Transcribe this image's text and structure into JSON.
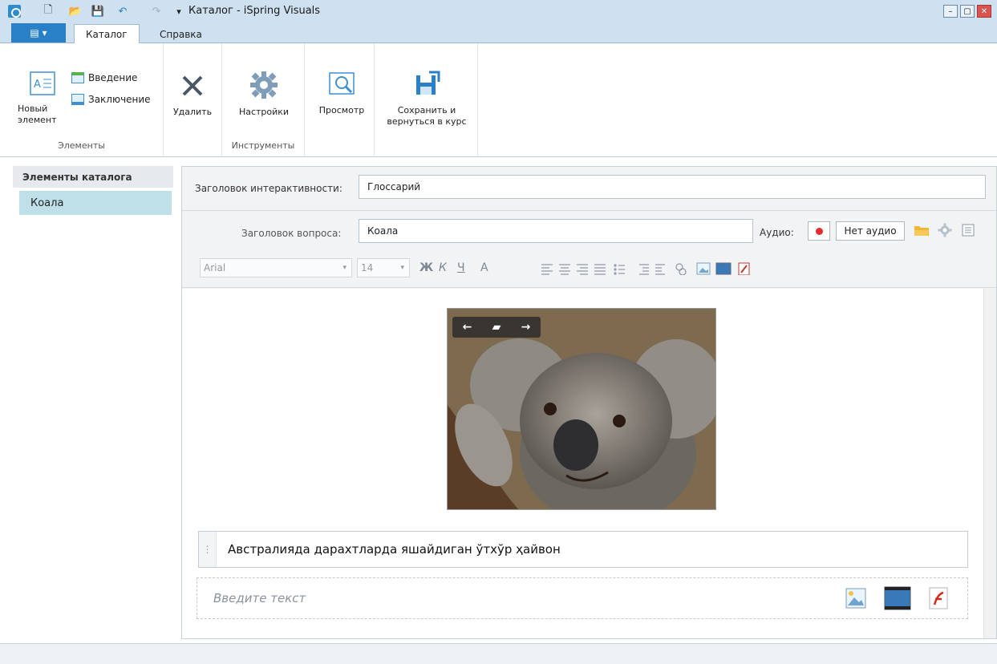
{
  "window": {
    "title": "Каталог - iSpring Visuals",
    "min_glyph": "–",
    "max_glyph": "▢",
    "close_glyph": "✕"
  },
  "quick_access": {
    "new_glyph": "🗋",
    "open_glyph": "📂",
    "save_glyph": "💾",
    "undo_glyph": "↶",
    "redo_glyph": "↷",
    "customize_glyph": "▾"
  },
  "tabs": {
    "file_glyph": "▤ ▾",
    "catalog": "Каталог",
    "help": "Справка"
  },
  "ribbon": {
    "elements_group": {
      "label": "Элементы",
      "new_item": "Новый элемент",
      "intro": "Введение",
      "outro": "Заключение"
    },
    "delete": "Удалить",
    "tools_group": {
      "label": "Инструменты",
      "settings": "Настройки"
    },
    "preview": "Просмотр",
    "save_return": "Сохранить и вернуться в курс"
  },
  "left_panel": {
    "header": "Элементы каталога",
    "items": [
      "Коала"
    ]
  },
  "form": {
    "interactivity_title_label": "Заголовок интерактивности:",
    "interactivity_title_value": "Глоссарий",
    "question_title_label": "Заголовок вопроса:",
    "question_title_value": "Коала",
    "audio_label": "Аудио:",
    "no_audio": "Нет аудио",
    "font": "Arial",
    "font_size": "14",
    "bold": "Ж",
    "italic": "К",
    "underline": "Ч",
    "font_color": "А"
  },
  "editor": {
    "photo_prev": "←",
    "photo_folder": "▰",
    "photo_next": "→",
    "description": "Австралияда дарахтларда яшайдиган ўтхўр ҳайвон",
    "placeholder": "Введите текст"
  }
}
